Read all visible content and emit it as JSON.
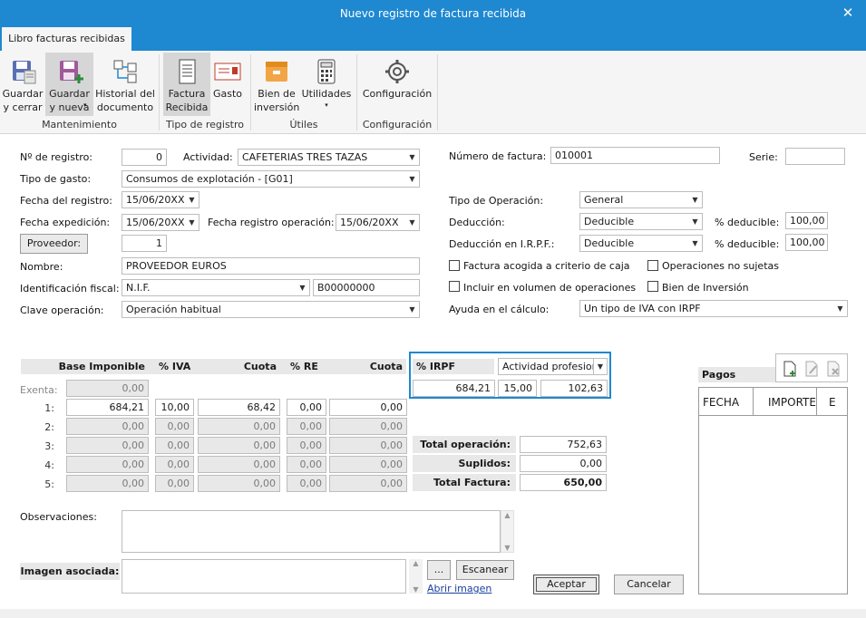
{
  "window": {
    "title": "Nuevo registro de factura recibida",
    "close_glyph": "✕"
  },
  "tab": "Libro facturas recibidas",
  "ribbon": {
    "groups": [
      {
        "name": "Mantenimiento"
      },
      {
        "name": "Tipo de registro"
      },
      {
        "name": "Útiles"
      },
      {
        "name": "Configuración"
      }
    ],
    "buttons": {
      "guardar_cerrar": "Guardar\ny cerrar",
      "guardar_nueva": "Guardar\ny nueva",
      "historial": "Historial del\ndocumento",
      "factura_recibida": "Factura\nRecibida",
      "gasto": "Gasto",
      "bien_inversion": "Bien de\ninversión",
      "utilidades": "Utilidades",
      "configuracion": "Configuración"
    }
  },
  "form": {
    "n_registro_label": "Nº de registro:",
    "n_registro": "0",
    "actividad_label": "Actividad:",
    "actividad": "CAFETERIAS TRES TAZAS",
    "tipo_gasto_label": "Tipo de gasto:",
    "tipo_gasto": "Consumos de explotación - [G01]",
    "fecha_registro_label": "Fecha del registro:",
    "fecha_registro": "15/06/20XX",
    "fecha_expedicion_label": "Fecha expedición:",
    "fecha_expedicion": "15/06/20XX",
    "fecha_reg_op_label": "Fecha registro operación:",
    "fecha_reg_op": "15/06/20XX",
    "proveedor_button": "Proveedor:",
    "proveedor": "1",
    "nombre_label": "Nombre:",
    "nombre": "PROVEEDOR EUROS",
    "ident_fiscal_label": "Identificación fiscal:",
    "ident_tipo": "N.I.F.",
    "ident_num": "B00000000",
    "clave_op_label": "Clave operación:",
    "clave_op": "Operación habitual",
    "num_factura_label": "Número de factura:",
    "num_factura": "010001",
    "serie_label": "Serie:",
    "serie": "",
    "tipo_operacion_label": "Tipo de Operación:",
    "tipo_operacion": "General",
    "deduccion_label": "Deducción:",
    "deduccion": "Deducible",
    "pct_deducible_label": "% deducible:",
    "pct_deducible": "100,00",
    "deduccion_irpf_label": "Deducción en I.R.P.F.:",
    "deduccion_irpf": "Deducible",
    "pct_deducible2": "100,00",
    "chk_criterio_caja": "Factura acogida a criterio de caja",
    "chk_no_sujetas": "Operaciones no sujetas",
    "chk_volumen": "Incluir en  volumen de operaciones",
    "chk_bien_inversion": "Bien de Inversión",
    "ayuda_calculo_label": "Ayuda en el cálculo:",
    "ayuda_calculo": "Un tipo de IVA con IRPF"
  },
  "iva_table": {
    "headers": {
      "base": "Base Imponible",
      "iva": "% IVA",
      "cuota": "Cuota",
      "re": "% RE",
      "cuota_re": "Cuota"
    },
    "exenta_label": "Exenta:",
    "exenta": "0,00",
    "rows": [
      {
        "label": "1:",
        "base": "684,21",
        "iva": "10,00",
        "cuota": "68,42",
        "re": "0,00",
        "cuota_re": "0,00"
      },
      {
        "label": "2:",
        "base": "0,00",
        "iva": "0,00",
        "cuota": "0,00",
        "re": "0,00",
        "cuota_re": "0,00"
      },
      {
        "label": "3:",
        "base": "0,00",
        "iva": "0,00",
        "cuota": "0,00",
        "re": "0,00",
        "cuota_re": "0,00"
      },
      {
        "label": "4:",
        "base": "0,00",
        "iva": "0,00",
        "cuota": "0,00",
        "re": "0,00",
        "cuota_re": "0,00"
      },
      {
        "label": "5:",
        "base": "0,00",
        "iva": "0,00",
        "cuota": "0,00",
        "re": "0,00",
        "cuota_re": "0,00"
      }
    ]
  },
  "irpf": {
    "label": "% IRPF",
    "tipo": "Actividad profesior",
    "base": "684,21",
    "pct": "15,00",
    "cuota": "102,63"
  },
  "totales": {
    "total_operacion_label": "Total operación:",
    "total_operacion": "752,63",
    "suplidos_label": "Suplidos:",
    "suplidos": "0,00",
    "total_factura_label": "Total Factura:",
    "total_factura": "650,00"
  },
  "pagos": {
    "title": "Pagos",
    "cols": [
      "FECHA",
      "IMPORTE",
      "E"
    ]
  },
  "observaciones_label": "Observaciones:",
  "imagen": {
    "label": "Imagen asociada:",
    "browse": "...",
    "escanear": "Escanear",
    "abrir": "Abrir imagen"
  },
  "aceptar": "Aceptar",
  "cancelar": "Cancelar"
}
